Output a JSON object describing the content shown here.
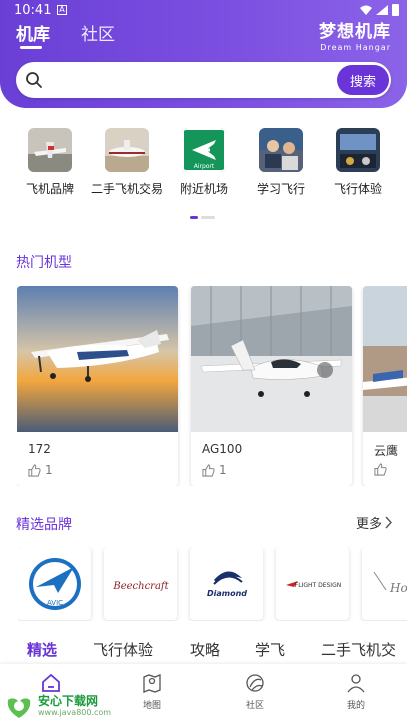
{
  "status_bar": {
    "time": "10:41",
    "indicator": "A"
  },
  "header": {
    "tabs": [
      {
        "label": "机库",
        "active": true
      },
      {
        "label": "社区",
        "active": false
      }
    ],
    "brand_cn": "梦想机库",
    "brand_en": "Dream Hangar"
  },
  "search": {
    "placeholder": "",
    "button_label": "搜索"
  },
  "categories": [
    {
      "label": "飞机品牌",
      "icon": "plane-brand-thumb"
    },
    {
      "label": "二手飞机交易",
      "icon": "used-plane-thumb"
    },
    {
      "label": "附近机场",
      "icon": "airport-icon",
      "badge": "Airport"
    },
    {
      "label": "学习飞行",
      "icon": "learn-flying-thumb"
    },
    {
      "label": "飞行体验",
      "icon": "flight-experience-thumb"
    }
  ],
  "hot_models": {
    "title": "热门机型",
    "items": [
      {
        "name": "172",
        "likes": "1"
      },
      {
        "name": "AG100",
        "likes": "1"
      },
      {
        "name": "云鹰",
        "likes": ""
      }
    ]
  },
  "brands": {
    "title": "精选品牌",
    "more_label": "更多",
    "items": [
      {
        "name": "AVIC",
        "logo_text": "AVIC"
      },
      {
        "name": "Beechcraft",
        "logo_text": "Beechcraft"
      },
      {
        "name": "Diamond",
        "logo_text": "Diamond"
      },
      {
        "name": "Flight Design",
        "logo_text": "FLIGHT DESIGN"
      },
      {
        "name": "Honda",
        "logo_text": "Hon"
      }
    ]
  },
  "content_tabs": [
    {
      "label": "精选",
      "active": true
    },
    {
      "label": "飞行体验",
      "active": false
    },
    {
      "label": "攻略",
      "active": false
    },
    {
      "label": "学飞",
      "active": false
    },
    {
      "label": "二手飞机交",
      "active": false
    }
  ],
  "bottom_nav": [
    {
      "label": "",
      "icon": "home-icon",
      "active": true
    },
    {
      "label": "地图",
      "icon": "map-pin-icon",
      "active": false
    },
    {
      "label": "社区",
      "icon": "community-icon",
      "active": false
    },
    {
      "label": "我的",
      "icon": "profile-icon",
      "active": false
    }
  ],
  "watermark": {
    "text": "安心下载网",
    "url": "www.java800.com"
  },
  "colors": {
    "accent": "#6a35d8",
    "header_gradient_start": "#6a3fd6",
    "header_gradient_end": "#8b63e8"
  }
}
